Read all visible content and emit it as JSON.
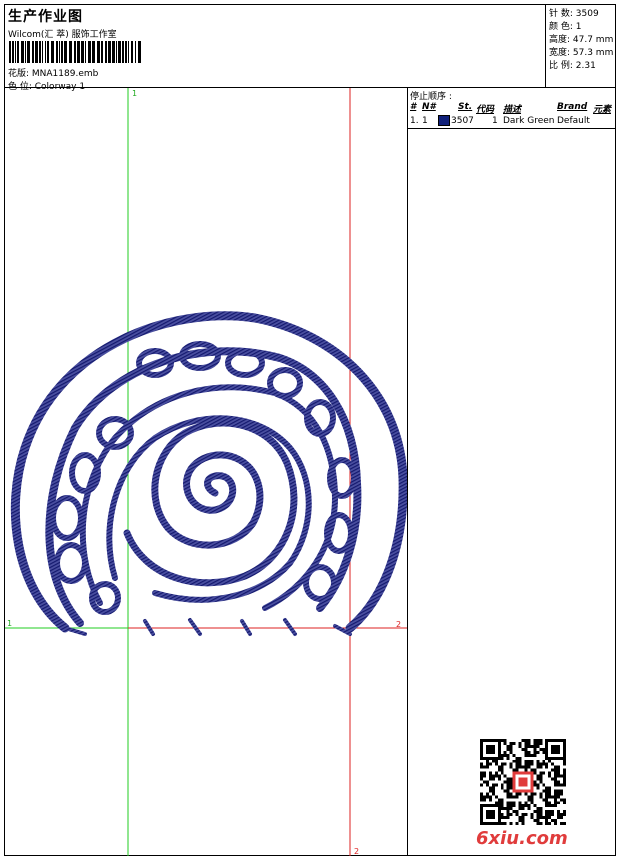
{
  "header": {
    "title": "生产作业图",
    "company": "Wilcom(汇 萃) 服饰工作室",
    "file_label": "花版: ",
    "file_name": "MNA1189.emb",
    "colorway_label": "色 位: ",
    "colorway_name": "Colorway 1"
  },
  "stats": [
    {
      "label": "针 数: ",
      "value": "3509"
    },
    {
      "label": "颜 色: ",
      "value": "1"
    },
    {
      "label": "高度: ",
      "value": "47.7 mm"
    },
    {
      "label": "宽度: ",
      "value": "57.3 mm"
    },
    {
      "label": "比 例: ",
      "value": "2.31"
    }
  ],
  "stop_sequence": {
    "title": "停止顺序 :",
    "headers": [
      "#",
      "N#",
      "St.",
      "代码",
      "描述",
      "Brand",
      "元素"
    ],
    "rows": [
      {
        "num": "1.",
        "needle": "1",
        "stitches": "3507",
        "code": "1",
        "description": "Dark Green",
        "brand": "Default",
        "color": "#10207a"
      }
    ]
  },
  "guides": {
    "green_top": "1",
    "green_left": "1",
    "red_right": "2",
    "red_bottom": "2",
    "green_color": "#22cc22",
    "red_color": "#dd2222"
  },
  "design": {
    "thread_color": "#1a1f7a",
    "motif": "spiral-snail-embroidery"
  },
  "watermark": {
    "text": "6xiu.com",
    "color": "#e03c3c"
  }
}
